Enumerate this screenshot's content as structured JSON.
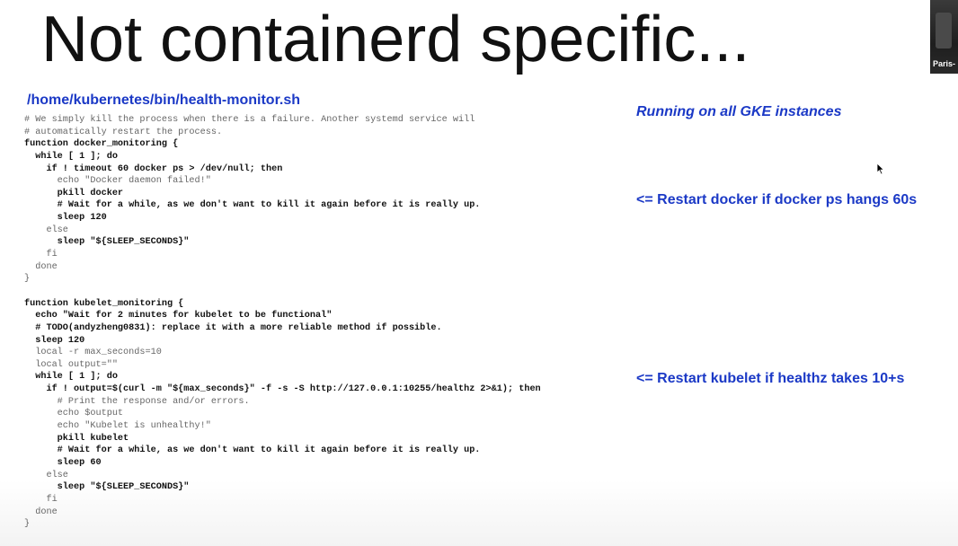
{
  "slide": {
    "title": "Not containerd specific...",
    "file_path": "/home/kubernetes/bin/health-monitor.sh",
    "code_lines": [
      "# We simply kill the process when there is a failure. Another systemd service will",
      "# automatically restart the process.",
      "function docker_monitoring {",
      "  while [ 1 ]; do",
      "    if ! timeout 60 docker ps > /dev/null; then",
      "      echo \"Docker daemon failed!\"",
      "      pkill docker",
      "      # Wait for a while, as we don't want to kill it again before it is really up.",
      "      sleep 120",
      "    else",
      "      sleep \"${SLEEP_SECONDS}\"",
      "    fi",
      "  done",
      "}",
      "",
      "function kubelet_monitoring {",
      "  echo \"Wait for 2 minutes for kubelet to be functional\"",
      "  # TODO(andyzheng0831): replace it with a more reliable method if possible.",
      "  sleep 120",
      "  local -r max_seconds=10",
      "  local output=\"\"",
      "  while [ 1 ]; do",
      "    if ! output=$(curl -m \"${max_seconds}\" -f -s -S http://127.0.0.1:10255/healthz 2>&1); then",
      "      # Print the response and/or errors.",
      "      echo $output",
      "      echo \"Kubelet is unhealthy!\"",
      "      pkill kubelet",
      "      # Wait for a while, as we don't want to kill it again before it is really up.",
      "      sleep 60",
      "    else",
      "      sleep \"${SLEEP_SECONDS}\"",
      "    fi",
      "  done",
      "}"
    ],
    "notes": {
      "gke": "Running on all GKE instances",
      "docker": "<= Restart docker if docker ps hangs 60s",
      "kubelet": "<= Restart kubelet if healthz takes 10+s"
    }
  },
  "participant": {
    "name": "Paris-"
  },
  "colors": {
    "accent_blue": "#1b39c6",
    "title_text": "#111111",
    "code_comment": "#666666"
  }
}
